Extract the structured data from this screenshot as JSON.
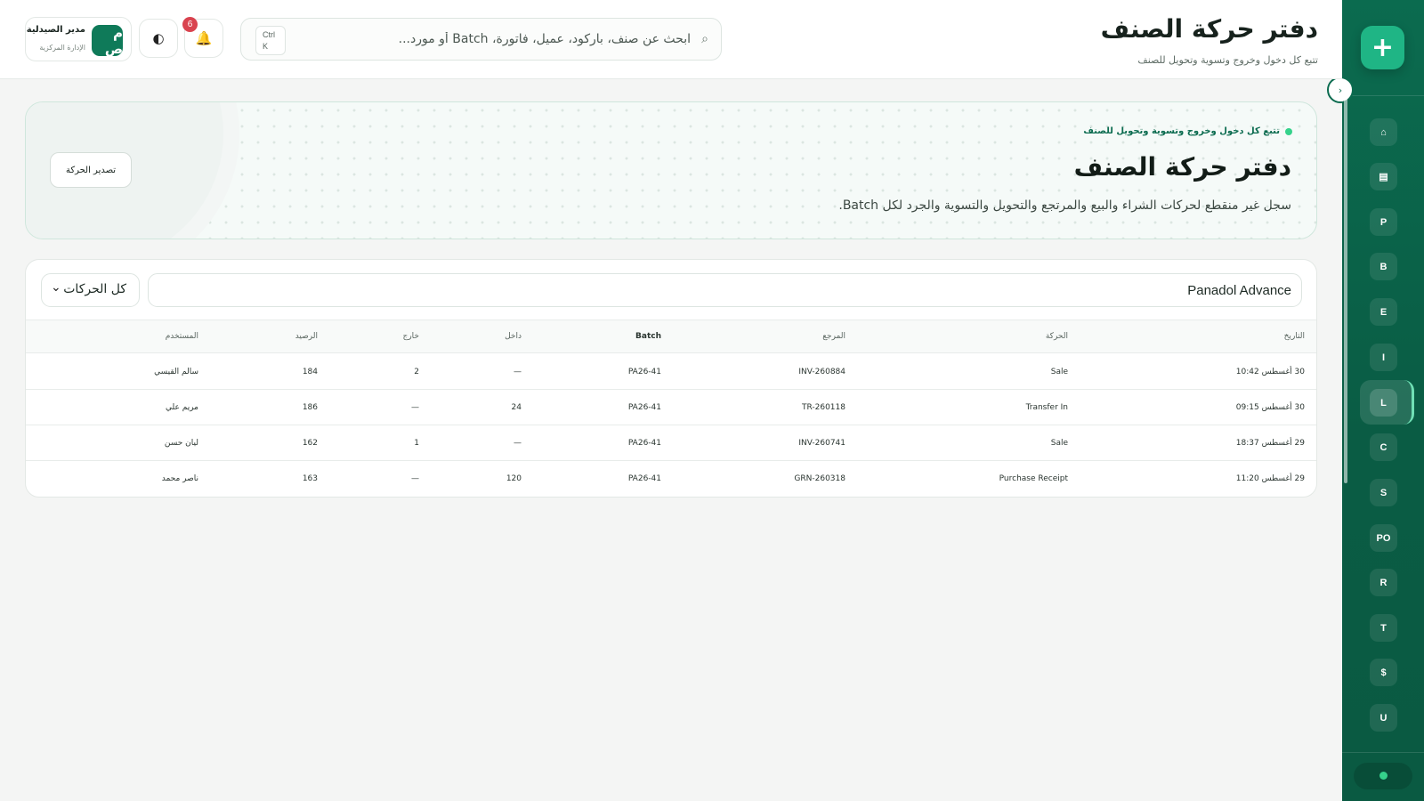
{
  "app": {
    "logo_glyph": "+",
    "accent": "#0b6b4f",
    "brand": "#1fb585"
  },
  "header": {
    "title": "دفتر حركة الصنف",
    "subtitle": "تتبع كل دخول وخروج وتسوية وتحويل للصنف",
    "search": {
      "placeholder": "ابحث عن صنف، باركود، عميل، فاتورة، Batch أو مورد...",
      "shortcut_1": "Ctrl",
      "shortcut_2": "K"
    },
    "notifications_count": "6",
    "user": {
      "initials": "م ص",
      "name": "مدير الصيدلية",
      "role": "الإدارة المركزية"
    }
  },
  "sidebar": {
    "items": [
      {
        "label": "⌂"
      },
      {
        "label": "▤"
      },
      {
        "label": "P"
      },
      {
        "label": "B"
      },
      {
        "label": "E"
      },
      {
        "label": "I"
      },
      {
        "label": "L"
      },
      {
        "label": "C"
      },
      {
        "label": "S"
      },
      {
        "label": "PO"
      },
      {
        "label": "R"
      },
      {
        "label": "T"
      },
      {
        "label": "$"
      },
      {
        "label": "U"
      }
    ],
    "active": "L"
  },
  "hero": {
    "tag": "تتبع كل دخول وخروج وتسوية وتحويل للصنف",
    "title": "دفتر حركة الصنف",
    "description": "سجل غير منقطع لحركات الشراء والبيع والمرتجع والتحويل والتسوية والجرد لكل Batch.",
    "export_label": "تصدير الحركة"
  },
  "filters": {
    "item_value": "Panadol Advance",
    "movement_type": "كل الحركات"
  },
  "table": {
    "columns": [
      "التاريخ",
      "الحركة",
      "المرجع",
      "Batch",
      "داخل",
      "خارج",
      "الرصيد",
      "المستخدم"
    ],
    "rows": [
      [
        "30 أغسطس 10:42",
        "Sale",
        "INV-260884",
        "PA26-41",
        "—",
        "2",
        "184",
        "سالم القيسي"
      ],
      [
        "30 أغسطس 09:15",
        "Transfer In",
        "TR-260118",
        "PA26-41",
        "24",
        "—",
        "186",
        "مريم علي"
      ],
      [
        "29 أغسطس 18:37",
        "Sale",
        "INV-260741",
        "PA26-41",
        "—",
        "1",
        "162",
        "ليان حسن"
      ],
      [
        "29 أغسطس 11:20",
        "Purchase Receipt",
        "GRN-260318",
        "PA26-41",
        "120",
        "—",
        "163",
        "ناصر محمد"
      ]
    ]
  }
}
